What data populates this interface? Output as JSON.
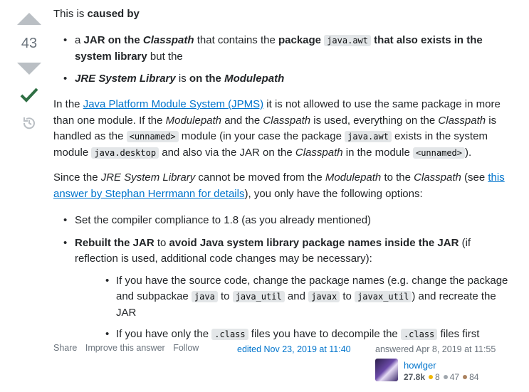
{
  "vote": {
    "count": "43"
  },
  "intro": {
    "text1": "This is ",
    "bold": "caused by"
  },
  "bullets1": [
    {
      "a": "a ",
      "b": "JAR on the ",
      "c": "Classpath",
      "d": " that contains the ",
      "e": "package",
      "code": "java.awt",
      "f": "that also exists in the system library",
      "g": " but the"
    },
    {
      "a": "JRE System Library",
      "b": " is ",
      "c": "on the ",
      "d": "Modulepath"
    }
  ],
  "jpms": {
    "t1": "In the ",
    "link": "Java Platform Module System (JPMS)",
    "t2": " it is not allowed to use the same package in more than one module. If the ",
    "i1": "Modulepath",
    "t3": " and the ",
    "i2": "Classpath",
    "t4": " is used, everything on the ",
    "i3": "Classpath",
    "t5": " is handled as the ",
    "c1": "<unnamed>",
    "t6": " module (in your case the package ",
    "c2": "java.awt",
    "t7": " exists in the system module ",
    "c3": "java.desktop",
    "t8": " and also via the JAR on the ",
    "i4": "Classpath",
    "t9": " in the module ",
    "c4": "<unnamed>",
    "t10": ")."
  },
  "since": {
    "t1": "Since the ",
    "i1": "JRE System Library",
    "t2": " cannot be moved from the ",
    "i2": "Modulepath",
    "t3": " to the ",
    "i3": "Classpath",
    "t4": " (see ",
    "link": "this answer by Stephan Herrmann for details",
    "t5": "), you only have the following options:"
  },
  "options": {
    "o1": "Set the compiler compliance to 1.8 (as you already mentioned)",
    "o2a": "Rebuilt the JAR",
    "o2b": " to ",
    "o2c": "avoid Java system library package names inside the JAR",
    "o2d": " (if reflection is used, additional code changes may be necessary):",
    "s1a": "If you have the source code, change the package names (e.g. change the package and subpackae ",
    "s1c1": "java",
    "s1b": " to ",
    "s1c2": "java_util",
    "s1d": " and ",
    "s1c3": "javax",
    "s1e": " to ",
    "s1c4": "javax_util",
    "s1f": ") and recreate the JAR",
    "s2a": "If you have only the ",
    "s2c1": ".class",
    "s2b": " files you have to decompile the ",
    "s2c2": ".class",
    "s2d": " files first"
  },
  "footer": {
    "share": "Share",
    "improve": "Improve this answer",
    "follow": "Follow",
    "edited": "edited Nov 23, 2019 at 11:40",
    "answered": "answered Apr 8, 2019 at 11:55",
    "user": "howlger",
    "rep": "27.8k",
    "gold": "8",
    "silver": "47",
    "bronze": "84"
  },
  "colors": {
    "link": "#0074cc",
    "accepted": "#2f6f44",
    "vote": "#babfc4"
  },
  "icons": [
    "vote-up-icon",
    "vote-down-icon",
    "accepted-checkmark-icon",
    "history-icon"
  ]
}
